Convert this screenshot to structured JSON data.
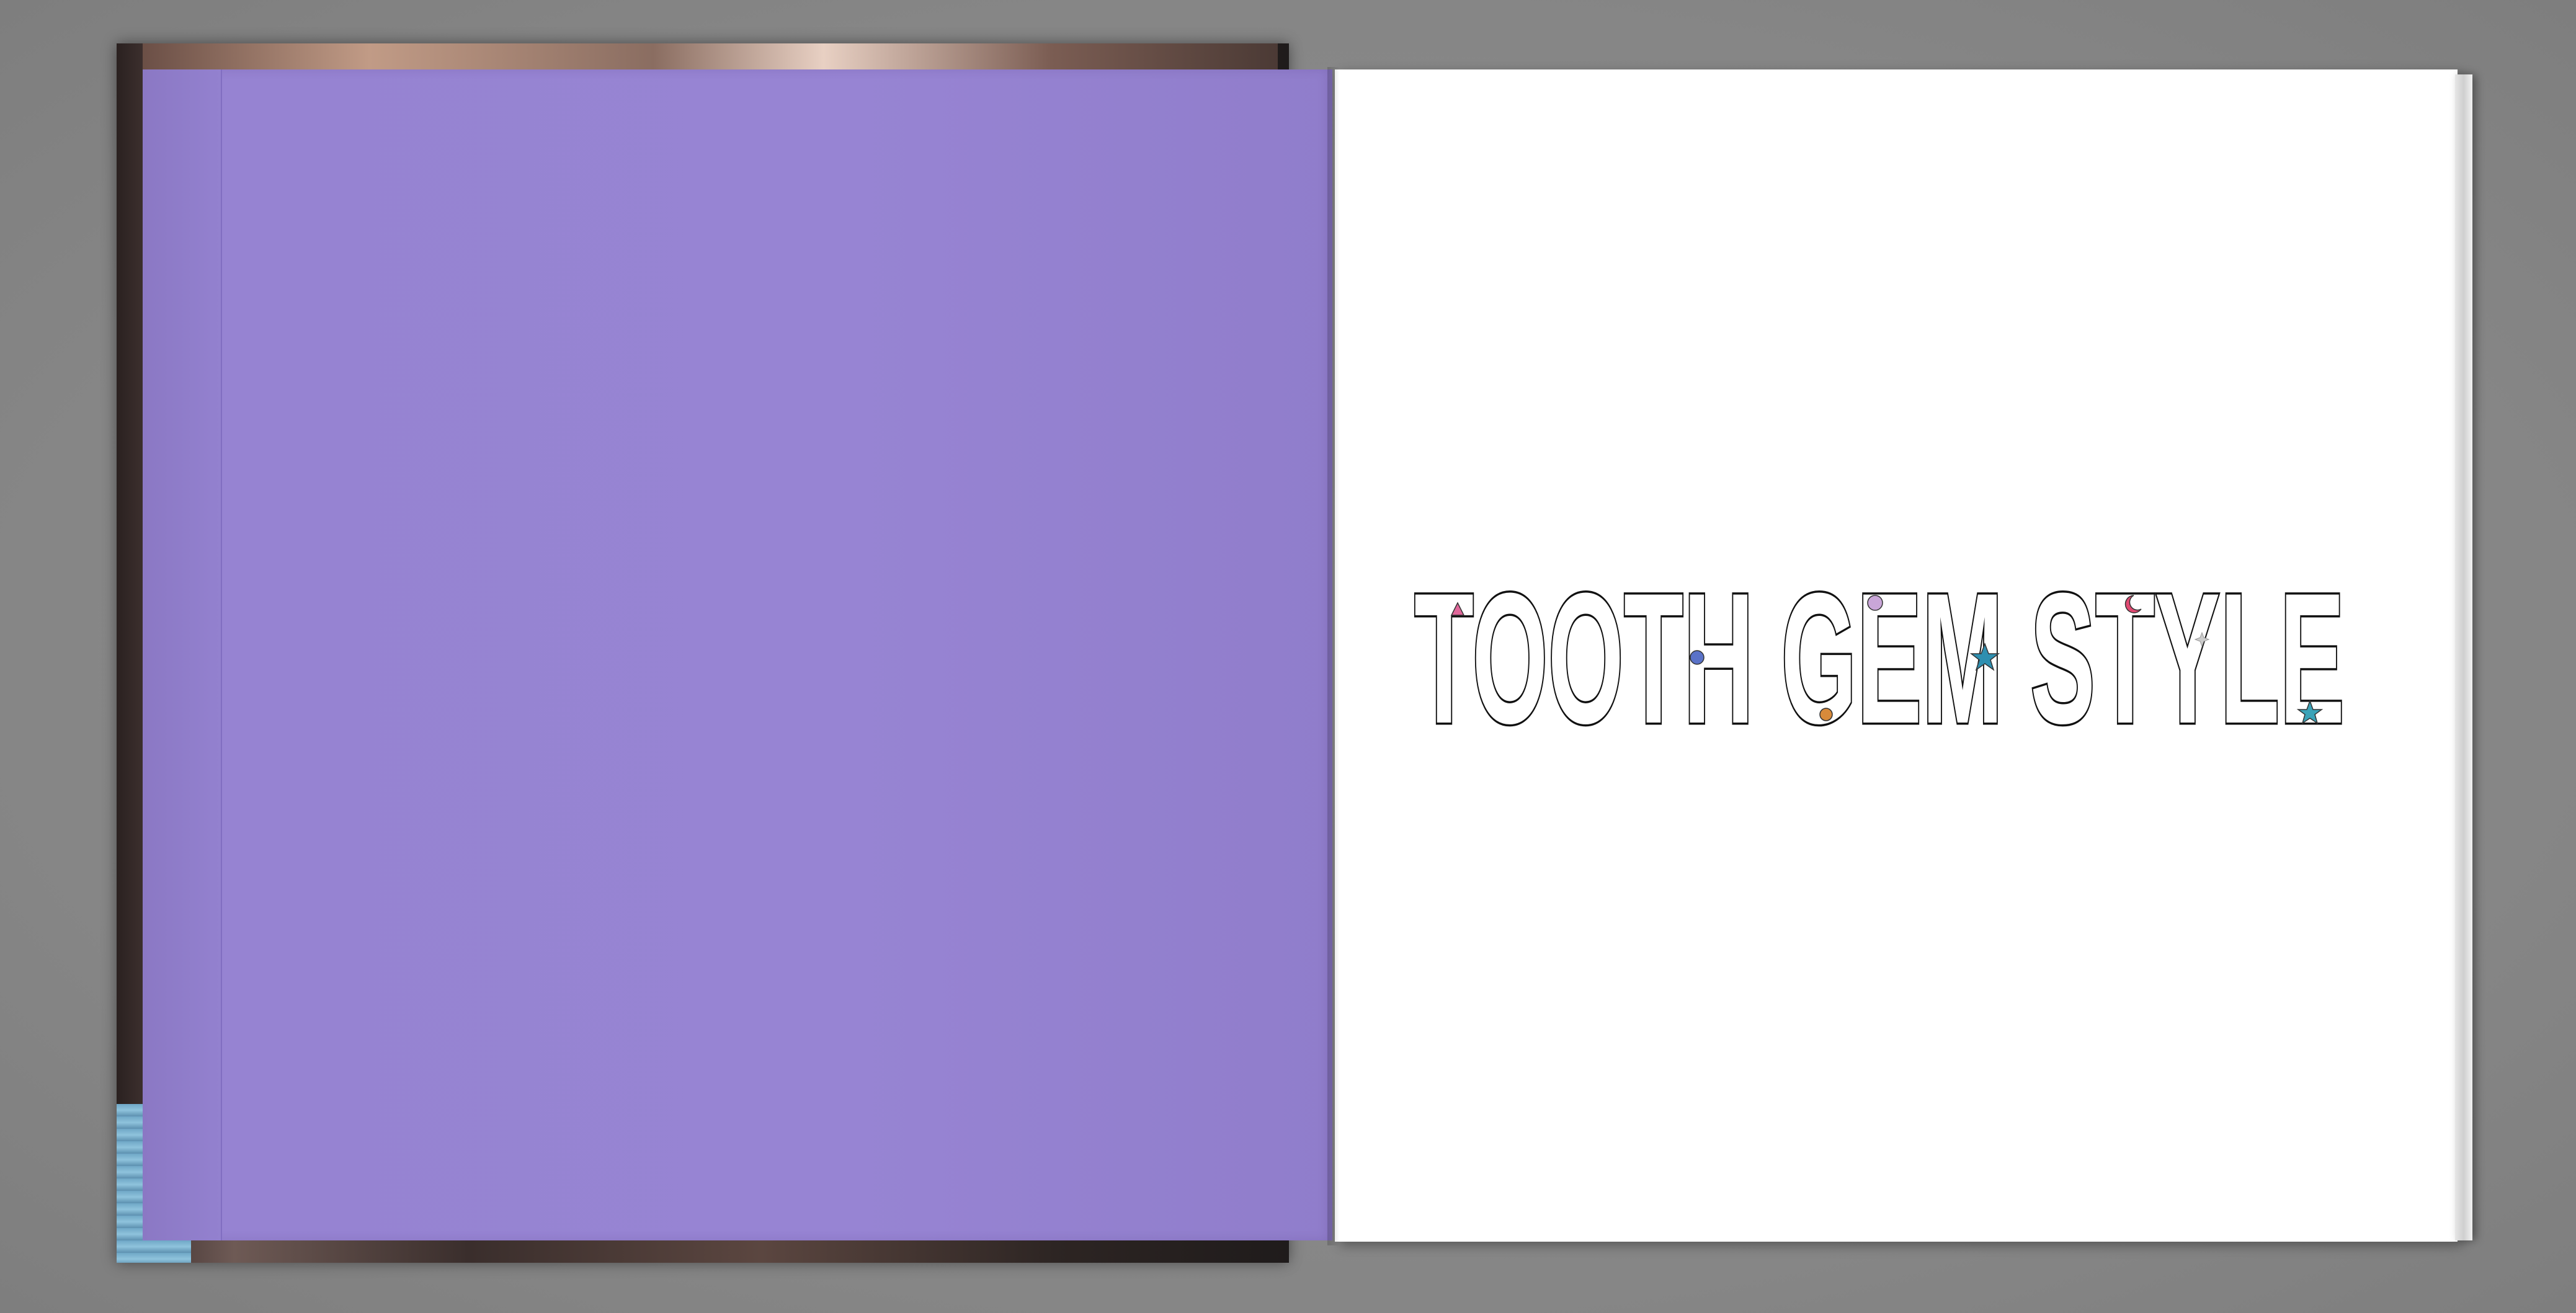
{
  "book": {
    "title": "TOOTH GEM STYLE",
    "endpaper_color": "#9683d2",
    "page_color": "#ffffff",
    "title_fill": "#ffffff",
    "title_outline": "#111111"
  },
  "gems": [
    {
      "name": "triangle-gem-icon",
      "color": "#e0679a"
    },
    {
      "name": "round-gem-icon",
      "color": "#5a72c8"
    },
    {
      "name": "round-gem-icon",
      "color": "#c9a6d8"
    },
    {
      "name": "round-gem-icon",
      "color": "#d88a3a"
    },
    {
      "name": "star-gem-icon",
      "color": "#2e8fb0"
    },
    {
      "name": "moon-gem-icon",
      "color": "#e04a72"
    },
    {
      "name": "sparkle-gem-icon",
      "color": "#cccccc"
    },
    {
      "name": "star-gem-icon",
      "color": "#3aa3b8"
    }
  ]
}
